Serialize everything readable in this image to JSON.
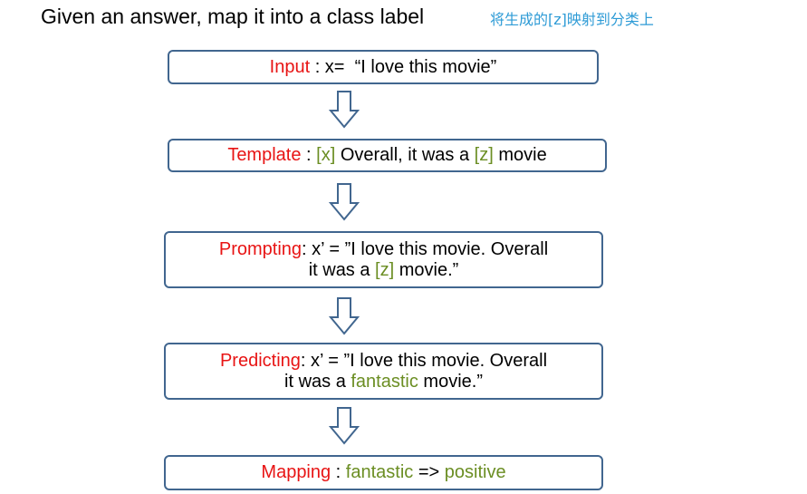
{
  "title": "Given an answer, map it into a class label",
  "note": "将生成的[z]映射到分类上",
  "steps": {
    "input": {
      "label": "Input",
      "sep": " : x=  ",
      "text": "“I love this movie”"
    },
    "template": {
      "label": "Template",
      "sep": " : ",
      "x_slot": "[x]",
      "mid": " Overall, it was a ",
      "z_slot": "[z]",
      "end": " movie"
    },
    "prompting": {
      "label": "Prompting",
      "line1": ": x’ = ”I love this movie. Overall",
      "line2_pre": "it was a ",
      "z_slot": "[z]",
      "line2_post": " movie.”"
    },
    "predicting": {
      "label": "Predicting",
      "line1": ": x’ = ”I love this movie. Overall",
      "line2_pre": "it was a ",
      "answer": "fantastic",
      "line2_post": " movie.”"
    },
    "mapping": {
      "label": "Mapping",
      "sep": " : ",
      "answer": "fantastic",
      "arrow": " => ",
      "class_label": "positive"
    }
  },
  "colors": {
    "label": "#e81414",
    "slot": "#6b8e23",
    "border": "#41668f",
    "note": "#2e9bd6"
  }
}
